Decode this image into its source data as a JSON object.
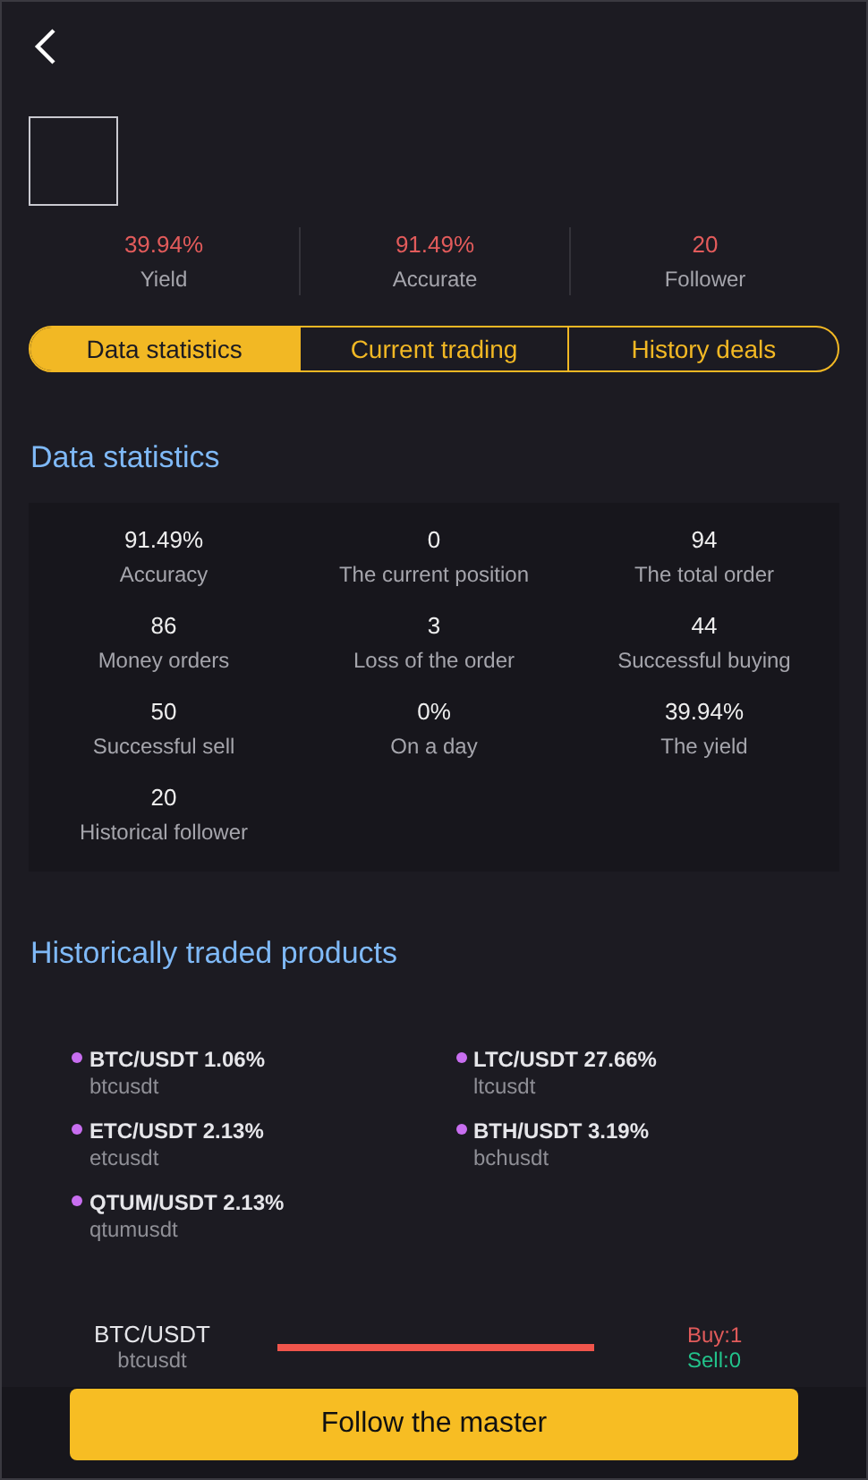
{
  "summary": [
    {
      "value": "39.94%",
      "label": "Yield"
    },
    {
      "value": "91.49%",
      "label": "Accurate"
    },
    {
      "value": "20",
      "label": "Follower"
    }
  ],
  "tabs": [
    {
      "label": "Data statistics",
      "selected": true
    },
    {
      "label": "Current trading",
      "selected": false
    },
    {
      "label": "History deals",
      "selected": false
    }
  ],
  "data_statistics": {
    "title": "Data statistics",
    "items": [
      {
        "value": "91.49%",
        "label": "Accuracy"
      },
      {
        "value": "0",
        "label": "The current position"
      },
      {
        "value": "94",
        "label": "The total order"
      },
      {
        "value": "86",
        "label": "Money orders"
      },
      {
        "value": "3",
        "label": "Loss of the order"
      },
      {
        "value": "44",
        "label": "Successful buying"
      },
      {
        "value": "50",
        "label": "Successful sell"
      },
      {
        "value": "0%",
        "label": "On a day"
      },
      {
        "value": "39.94%",
        "label": "The yield"
      },
      {
        "value": "20",
        "label": "Historical follower"
      }
    ]
  },
  "traded_products": {
    "title": "Historically traded products",
    "items": [
      {
        "name": "BTC/USDT 1.06%",
        "code": "btcusdt",
        "color": "#c86ef0"
      },
      {
        "name": "LTC/USDT 27.66%",
        "code": "ltcusdt",
        "color": "#c86ef0"
      },
      {
        "name": "ETC/USDT 2.13%",
        "code": "etcusdt",
        "color": "#c86ef0"
      },
      {
        "name": "BTH/USDT 3.19%",
        "code": "bchusdt",
        "color": "#c86ef0"
      },
      {
        "name": "QTUM/USDT 2.13%",
        "code": "qtumusdt",
        "color": "#c86ef0"
      }
    ]
  },
  "position": {
    "pair": "BTC/USDT",
    "code": "btcusdt",
    "level": 1,
    "buy": "Buy:1",
    "sell": "Sell:0"
  },
  "follow_button": "Follow the master"
}
